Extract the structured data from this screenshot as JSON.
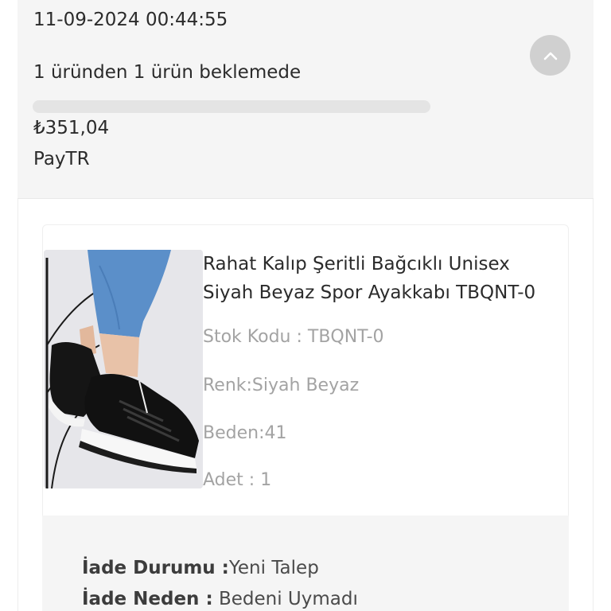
{
  "order": {
    "date": "11-09-2024 00:44:55",
    "status_text": "1 üründen 1 ürün beklemede",
    "progress": 0,
    "total": "₺351,04",
    "payment_method": "PayTR",
    "collapse_icon": "chevron-up-icon"
  },
  "product": {
    "title_line1": "Rahat Kalıp Şeritli Bağcıklı Unisex",
    "title_line2": "Siyah Beyaz Spor Ayakkabı TBQNT-0",
    "stock_code": "Stok Kodu : TBQNT-0",
    "color": "Renk:Siyah Beyaz",
    "size": "Beden:41",
    "quantity": "Adet : 1"
  },
  "return": {
    "status_label": "İade Durumu :",
    "status_value": "Yeni Talep",
    "reason_label": "İade Neden :",
    "reason_value": " Bedeni Uymadı"
  },
  "colors": {
    "panel_bg": "#f5f5f5",
    "button_bg": "#d0d0d0",
    "muted_text": "#a3a3a3"
  }
}
